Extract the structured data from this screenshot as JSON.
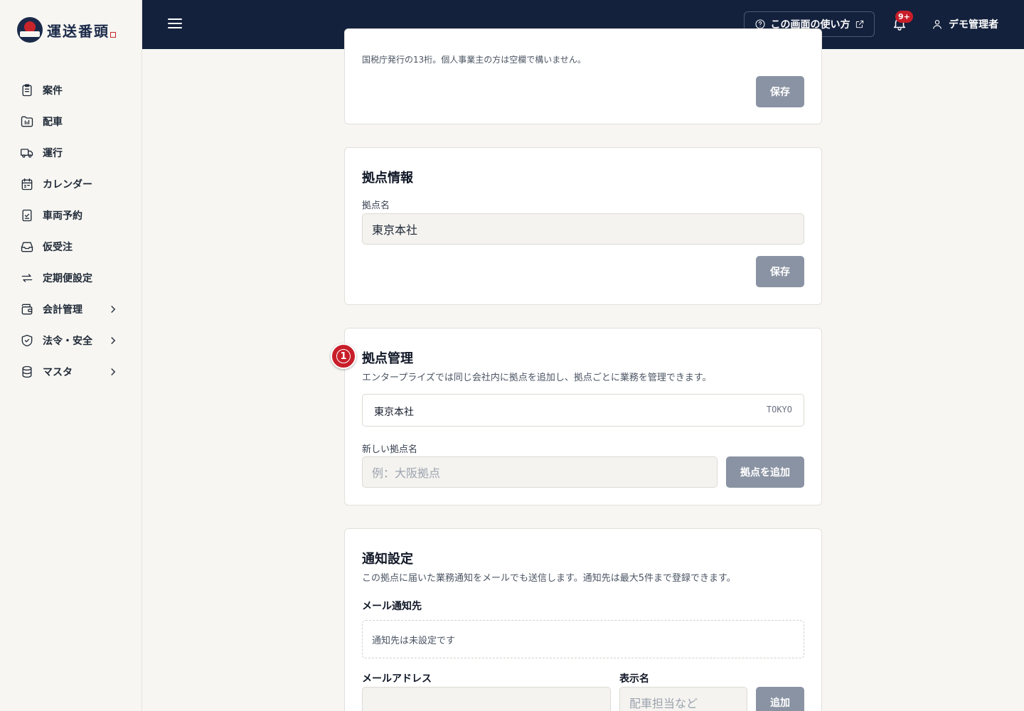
{
  "app": {
    "logo_text": "運送番頭"
  },
  "sidebar": {
    "items": [
      {
        "label": "案件",
        "icon": "clipboard-icon"
      },
      {
        "label": "配車",
        "icon": "folder-chart-icon"
      },
      {
        "label": "運行",
        "icon": "truck-icon"
      },
      {
        "label": "カレンダー",
        "icon": "calendar-icon"
      },
      {
        "label": "車両予約",
        "icon": "clipboard-check-icon"
      },
      {
        "label": "仮受注",
        "icon": "inbox-icon"
      },
      {
        "label": "定期便設定",
        "icon": "repeat-icon"
      },
      {
        "label": "会計管理",
        "icon": "wallet-icon",
        "expandable": true
      },
      {
        "label": "法令・安全",
        "icon": "shield-check-icon",
        "expandable": true
      },
      {
        "label": "マスタ",
        "icon": "database-icon",
        "expandable": true
      }
    ]
  },
  "header": {
    "help_label": "この画面の使い方",
    "notification_badge": "9+",
    "user_name": "デモ管理者"
  },
  "company_card": {
    "hint": "国税庁発行の13桁。個人事業主の方は空欄で構いません。",
    "save_label": "保存"
  },
  "office_info": {
    "title": "拠点情報",
    "name_label": "拠点名",
    "name_value": "東京本社",
    "save_label": "保存"
  },
  "office_management": {
    "step_number": "1",
    "title": "拠点管理",
    "description": "エンタープライズでは同じ会社内に拠点を追加し、拠点ごとに業務を管理できます。",
    "offices": [
      {
        "name": "東京本社",
        "code": "TOKYO"
      }
    ],
    "new_label": "新しい拠点名",
    "new_placeholder": "例：大阪拠点",
    "add_label": "拠点を追加"
  },
  "notification_settings": {
    "title": "通知設定",
    "description": "この拠点に届いた業務通知をメールでも送信します。通知先は最大5件まで登録できます。",
    "recipients_label": "メール通知先",
    "empty_text": "通知先は未設定です",
    "email_label": "メールアドレス",
    "email_value": "",
    "display_name_label": "表示名",
    "display_name_placeholder": "配車担当など",
    "add_label": "追加"
  },
  "colors": {
    "navy": "#14213d",
    "accent_red": "#c81e2a",
    "button_gray": "#8a93a3"
  }
}
